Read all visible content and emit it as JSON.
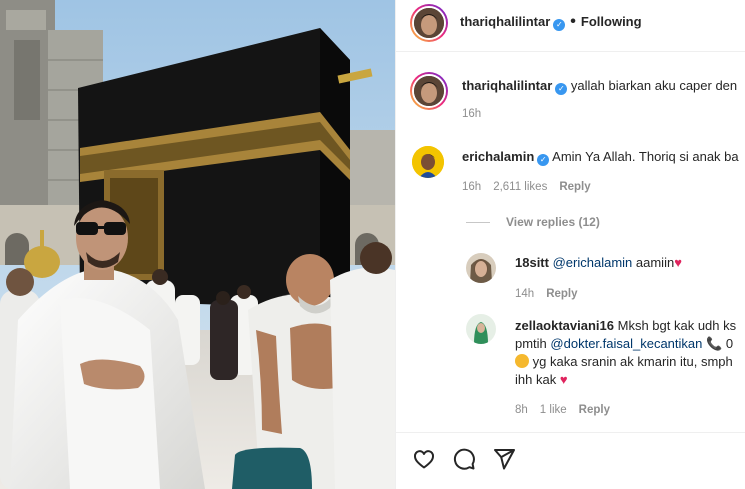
{
  "header": {
    "username": "thariqhalilintar",
    "separator": "•",
    "follow_status": "Following"
  },
  "caption": {
    "username": "thariqhalilintar",
    "text": "yallah biarkan aku caper den",
    "time": "16h"
  },
  "comments": [
    {
      "username": "erichalamin",
      "verified": true,
      "text": "Amin Ya Allah. Thoriq si anak ba",
      "time": "16h",
      "likes": "2,611 likes",
      "reply_label": "Reply",
      "view_replies": "View replies (12)"
    },
    {
      "username": "18sitt",
      "mention": "@erichalamin",
      "text": "aamiin",
      "time": "14h",
      "reply_label": "Reply"
    },
    {
      "username": "zellaoktaviani16",
      "text_line1": "Mksh bgt kak udh ks",
      "text_line2_prefix": "pmtih",
      "mention": "@dokter.faisal_kecantikan",
      "text_line2_suffix": "0",
      "text_line3": "yg kaka sranin ak kmarin itu, smph",
      "text_line4": "ihh kak",
      "time": "8h",
      "likes": "1 like",
      "reply_label": "Reply"
    }
  ],
  "actions": {
    "like_icon": "heart-outline-icon",
    "comment_icon": "comment-bubble-icon",
    "share_icon": "paper-plane-icon"
  },
  "colors": {
    "verified": "#3897f0",
    "mention": "#00376b",
    "heart": "#e0245e",
    "muted": "#8e8e8e"
  }
}
